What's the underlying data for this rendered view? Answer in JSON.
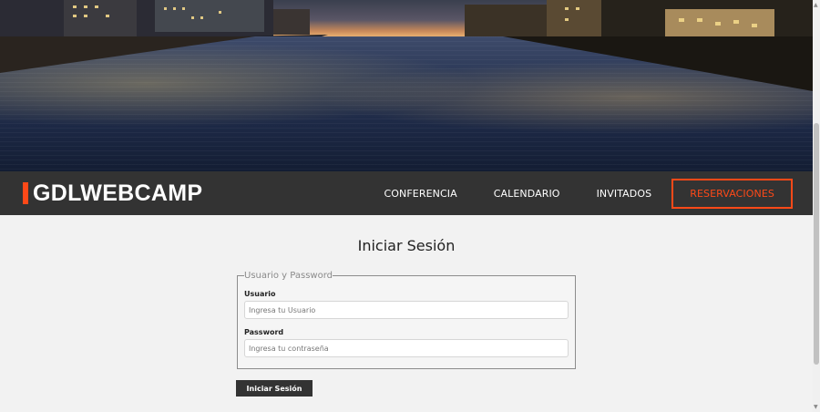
{
  "brand": {
    "name": "GDLWEBCAMP",
    "accent_color": "#fe4918"
  },
  "nav": {
    "items": [
      {
        "label": "CONFERENCIA"
      },
      {
        "label": "CALENDARIO"
      },
      {
        "label": "INVITADOS"
      },
      {
        "label": "RESERVACIONES",
        "highlighted": true
      }
    ]
  },
  "hero": {
    "image": "city-river-night-skyline"
  },
  "login": {
    "title": "Iniciar Sesión",
    "fieldset_legend": "Usuario y Password",
    "username_label": "Usuario",
    "username_placeholder": "Ingresa tu Usuario",
    "username_value": "",
    "password_label": "Password",
    "password_placeholder": "Ingresa tu contraseña",
    "password_value": "",
    "submit_label": "Iniciar Sesión"
  },
  "colors": {
    "navbar_bg": "#333333",
    "page_bg": "#f2f2f2",
    "button_bg": "#333333"
  }
}
